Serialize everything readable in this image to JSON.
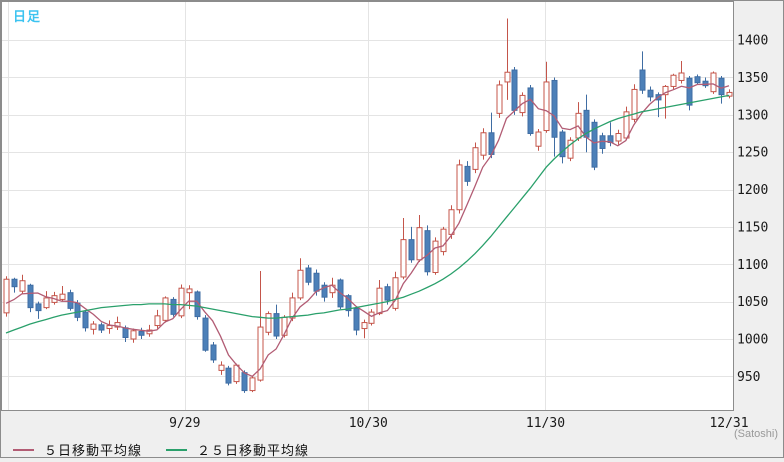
{
  "header": {
    "title": "日足",
    "watermark": "(Satoshi)"
  },
  "legend": {
    "ma5_label": "５日移動平均線",
    "ma25_label": "２５日移動平均線"
  },
  "colors": {
    "bull": "#c4554a",
    "bull_fill": "#ffffff",
    "bear": "#3f6da3",
    "bear_fill": "#4c80b8",
    "ma5": "#b25c74",
    "ma25": "#2aa06b",
    "title": "#3cc3f0",
    "grid": "#e4e4e4",
    "border": "#8c8c8c",
    "axis_bg": "#efefef",
    "plot_bg": "#ffffff",
    "text": "#1a1a1a",
    "muted": "#999999"
  },
  "chart_data": {
    "type": "candlestick",
    "title": "日足",
    "xlabel": "",
    "ylabel": "",
    "grid": true,
    "legend_position": "bottom",
    "ylim": [
      905,
      1451
    ],
    "y_ticks": [
      950,
      1000,
      1050,
      1100,
      1150,
      1200,
      1250,
      1300,
      1350,
      1400
    ],
    "x_ticks": [
      {
        "label": "9/29",
        "i": 22.5,
        "line": true
      },
      {
        "label": "10/30",
        "i": 45.6,
        "line": true
      },
      {
        "label": "11/30",
        "i": 67.9,
        "line": true
      },
      {
        "label": "12/31",
        "i": 91.0,
        "line": false
      }
    ],
    "extra_gridline_i": 0.25,
    "candles": {
      "open": [
        1035,
        1080,
        1064,
        1072,
        1047,
        1042,
        1049,
        1053,
        1062,
        1048,
        1036,
        1013,
        1019,
        1014,
        1016,
        1015,
        1000,
        1010,
        1007,
        1018,
        1025,
        1053,
        1031,
        1062,
        1063,
        1028,
        992,
        958,
        961,
        943,
        955,
        931,
        945,
        1009,
        1034,
        1005,
        1028,
        1055,
        1095,
        1088,
        1072,
        1062,
        1079,
        1058,
        1041,
        1014,
        1021,
        1034,
        1070,
        1041,
        1083,
        1133,
        1106,
        1145,
        1089,
        1117,
        1140,
        1173,
        1231,
        1227,
        1246,
        1276,
        1302,
        1344,
        1360,
        1303,
        1336,
        1258,
        1279,
        1346,
        1277,
        1242,
        1269,
        1306,
        1290,
        1272,
        1272,
        1265,
        1269,
        1294,
        1360,
        1333,
        1327,
        1327,
        1338,
        1346,
        1349,
        1351,
        1345,
        1331,
        1349,
        1325
      ],
      "high": [
        1084,
        1082,
        1086,
        1074,
        1050,
        1064,
        1063,
        1071,
        1066,
        1052,
        1038,
        1024,
        1022,
        1025,
        1030,
        1018,
        1014,
        1015,
        1019,
        1039,
        1057,
        1056,
        1073,
        1072,
        1065,
        1032,
        996,
        970,
        964,
        967,
        958,
        950,
        1091,
        1037,
        1046,
        1032,
        1062,
        1108,
        1099,
        1093,
        1076,
        1082,
        1081,
        1060,
        1044,
        1026,
        1040,
        1079,
        1074,
        1090,
        1162,
        1150,
        1166,
        1152,
        1136,
        1150,
        1179,
        1240,
        1238,
        1263,
        1282,
        1303,
        1346,
        1429,
        1364,
        1330,
        1340,
        1281,
        1371,
        1350,
        1280,
        1270,
        1317,
        1327,
        1294,
        1276,
        1290,
        1280,
        1311,
        1341,
        1385,
        1338,
        1330,
        1340,
        1355,
        1372,
        1352,
        1354,
        1350,
        1358,
        1352,
        1334
      ],
      "low": [
        1030,
        1062,
        1060,
        1036,
        1027,
        1040,
        1046,
        1050,
        1038,
        1024,
        1010,
        1006,
        1008,
        1007,
        1012,
        996,
        995,
        1000,
        1003,
        1014,
        1022,
        1030,
        1028,
        1040,
        1026,
        983,
        968,
        952,
        938,
        940,
        928,
        929,
        943,
        1005,
        1000,
        1002,
        1024,
        1052,
        1072,
        1058,
        1050,
        1055,
        1040,
        1030,
        1005,
        1001,
        1018,
        1032,
        1046,
        1038,
        1080,
        1102,
        1103,
        1085,
        1086,
        1112,
        1134,
        1168,
        1205,
        1222,
        1240,
        1242,
        1296,
        1320,
        1300,
        1298,
        1272,
        1252,
        1276,
        1244,
        1235,
        1238,
        1265,
        1250,
        1226,
        1248,
        1258,
        1260,
        1266,
        1290,
        1328,
        1318,
        1297,
        1295,
        1334,
        1342,
        1306,
        1340,
        1336,
        1328,
        1315,
        1322
      ],
      "close": [
        1080,
        1070,
        1078,
        1042,
        1038,
        1055,
        1058,
        1060,
        1041,
        1029,
        1015,
        1020,
        1012,
        1018,
        1022,
        1002,
        1011,
        1005,
        1012,
        1031,
        1055,
        1033,
        1068,
        1067,
        1030,
        985,
        972,
        965,
        941,
        965,
        931,
        948,
        1016,
        1034,
        1004,
        1029,
        1055,
        1092,
        1076,
        1064,
        1056,
        1072,
        1043,
        1038,
        1012,
        1022,
        1036,
        1068,
        1052,
        1082,
        1133,
        1106,
        1149,
        1090,
        1131,
        1147,
        1173,
        1233,
        1211,
        1256,
        1276,
        1247,
        1340,
        1357,
        1306,
        1326,
        1275,
        1277,
        1344,
        1270,
        1244,
        1266,
        1302,
        1270,
        1230,
        1255,
        1263,
        1275,
        1304,
        1334,
        1333,
        1324,
        1320,
        1338,
        1353,
        1356,
        1313,
        1343,
        1339,
        1356,
        1327,
        1330
      ]
    },
    "series": [
      {
        "name": "５日移動平均線",
        "key": "ma5",
        "values": [
          1047.8,
          1052.8,
          1060.4,
          1061.2,
          1061.6,
          1056.6,
          1054.2,
          1050.6,
          1050.4,
          1048.6,
          1040.6,
          1033,
          1023.4,
          1018.8,
          1017.4,
          1014.8,
          1013,
          1011.6,
          1010.4,
          1012.2,
          1022.8,
          1027.2,
          1039.8,
          1050.8,
          1050.6,
          1036.6,
          1024.4,
          1003.8,
          978.6,
          965.6,
          954.8,
          950,
          960.2,
          978.8,
          986.6,
          1006.2,
          1027.6,
          1042.8,
          1051.2,
          1063.2,
          1068.6,
          1072,
          1062.2,
          1054.6,
          1044.2,
          1037.4,
          1030.2,
          1035.2,
          1038,
          1052,
          1074.2,
          1088.2,
          1104.4,
          1112,
          1121.8,
          1124.6,
          1138,
          1154.8,
          1179,
          1204,
          1229.8,
          1244.6,
          1266,
          1295.2,
          1305.2,
          1315.2,
          1320.8,
          1308.2,
          1305.6,
          1298.4,
          1282,
          1280.2,
          1285.2,
          1270.4,
          1262.4,
          1264.6,
          1264,
          1258.6,
          1265.4,
          1286.2,
          1301.8,
          1314,
          1323,
          1329.8,
          1333.6,
          1338.2,
          1336,
          1340.6,
          1340.8,
          1341.4,
          1335.6,
          1339
        ]
      },
      {
        "name": "２５日移動平均線",
        "key": "ma25",
        "values": [
          1008,
          1012,
          1016,
          1020,
          1023,
          1026,
          1029,
          1032,
          1034,
          1036,
          1038,
          1040,
          1042,
          1043,
          1044,
          1045,
          1046,
          1046,
          1047,
          1047,
          1047,
          1046,
          1046,
          1045,
          1044,
          1042,
          1040,
          1038,
          1036,
          1034,
          1032,
          1030,
          1029,
          1028,
          1028,
          1029,
          1030,
          1031,
          1032,
          1034,
          1035,
          1037,
          1039,
          1040,
          1042,
          1044,
          1046,
          1048,
          1050,
          1053,
          1056,
          1060,
          1064,
          1069,
          1074,
          1080,
          1087,
          1095,
          1104,
          1114,
          1125,
          1137,
          1150,
          1163,
          1176,
          1189,
          1202,
          1216,
          1230,
          1241,
          1251,
          1260,
          1268,
          1275,
          1281,
          1286,
          1291,
          1295,
          1298,
          1301,
          1304,
          1306,
          1308,
          1310,
          1312,
          1314,
          1316,
          1318,
          1320,
          1322,
          1324,
          1326
        ]
      }
    ]
  }
}
